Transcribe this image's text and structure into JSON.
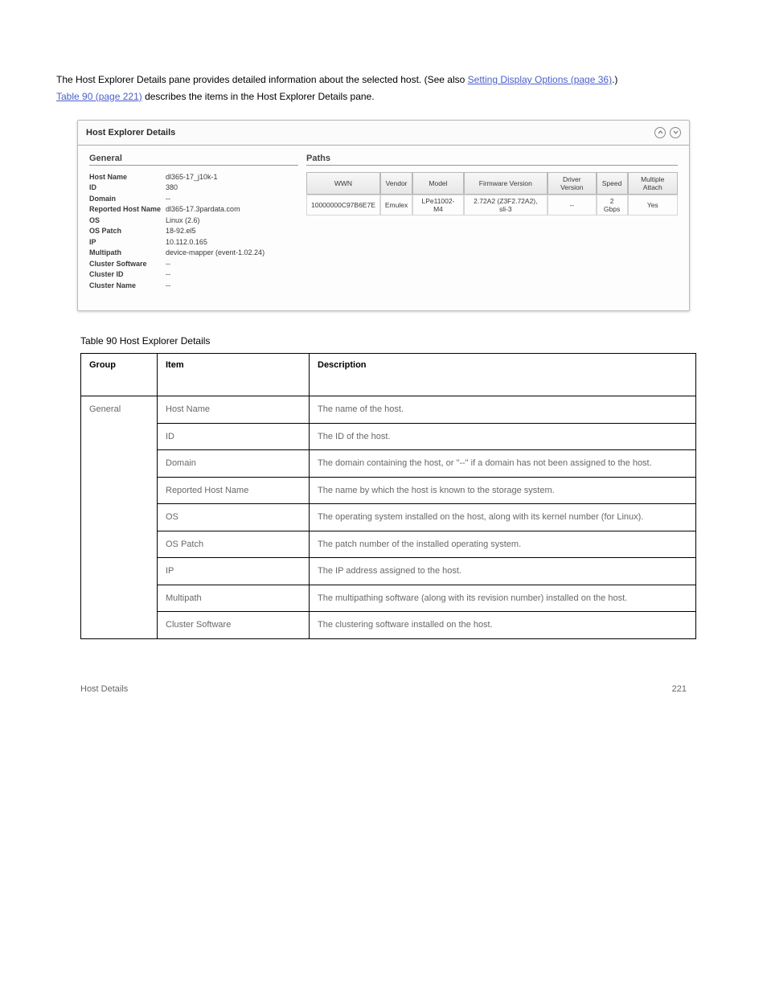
{
  "intro": {
    "line1": "The Host Explorer Details pane provides detailed information about the selected host. (See also",
    "link": "Setting Display Options (page 36)",
    "after_link": ".)",
    "xref_prefix": "Table 90 (page 221)",
    "xref_rest": " describes the items in the Host Explorer Details pane."
  },
  "panel": {
    "title": "Host Explorer Details",
    "general": "General",
    "paths": "Paths",
    "kv": [
      {
        "label": "Host Name",
        "value": "dl365-17_j10k-1"
      },
      {
        "label": "ID",
        "value": "380"
      },
      {
        "label": "Domain",
        "value": "--"
      },
      {
        "label": "Reported Host Name",
        "value": "dl365-17.3pardata.com"
      },
      {
        "label": "OS",
        "value": "Linux (2.6)"
      },
      {
        "label": "OS Patch",
        "value": "18-92.el5"
      },
      {
        "label": "IP",
        "value": "10.112.0.165"
      },
      {
        "label": "Multipath",
        "value": "device-mapper (event-1.02.24)"
      },
      {
        "label": "Cluster Software",
        "value": "--"
      },
      {
        "label": "Cluster ID",
        "value": "--"
      },
      {
        "label": "Cluster Name",
        "value": "--"
      }
    ],
    "paths_headers": [
      "WWN",
      "Vendor",
      "Model",
      "Firmware Version",
      "Driver Version",
      "Speed",
      "Multiple Attach"
    ],
    "paths_row": [
      "10000000C97B6E7E",
      "Emulex",
      "LPe11002-M4",
      "2.72A2 (Z3F2.72A2), sli-3",
      "--",
      "2 Gbps",
      "Yes"
    ]
  },
  "table_cap": "Table 90 Host Explorer Details",
  "headers": [
    "Group",
    "Item",
    "Description"
  ],
  "group_label": "General",
  "rows": [
    {
      "item": "Host Name",
      "desc": "The name of the host."
    },
    {
      "item": "ID",
      "desc": "The ID of the host."
    },
    {
      "item": "Domain",
      "desc": "The domain containing the host, or \"--\" if a domain has not been assigned to the host."
    },
    {
      "item": "Reported Host Name",
      "desc": "The name by which the host is known to the storage system."
    },
    {
      "item": "OS",
      "desc": "The operating system installed on the host, along with its kernel number (for Linux)."
    },
    {
      "item": "OS Patch",
      "desc": "The patch number of the installed operating system."
    },
    {
      "item": "IP",
      "desc": "The IP address assigned to the host."
    },
    {
      "item": "Multipath",
      "desc": "The multipathing software (along with its revision number) installed on the host."
    },
    {
      "item": "Cluster Software",
      "desc": "The clustering software installed on the host."
    }
  ],
  "footer_left": "Host Details",
  "footer_right": "221"
}
